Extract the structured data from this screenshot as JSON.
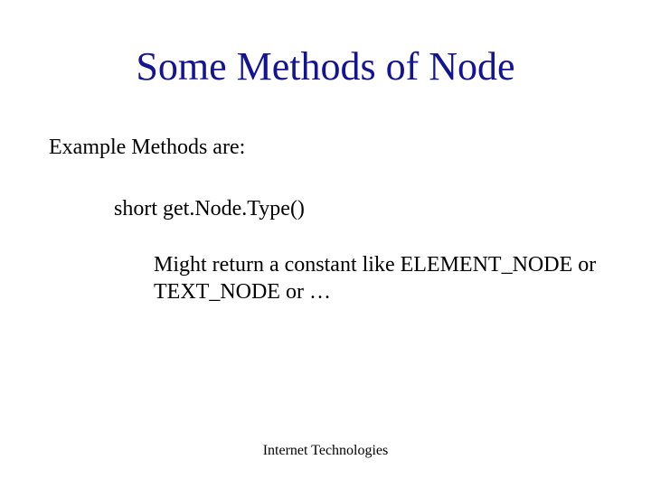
{
  "title": "Some Methods of Node",
  "subtitle": "Example Methods are:",
  "method": {
    "signature": "short get.Node.Type()",
    "description": " Might return a constant like ELEMENT_NODE or TEXT_NODE or …"
  },
  "footer": "Internet Technologies"
}
